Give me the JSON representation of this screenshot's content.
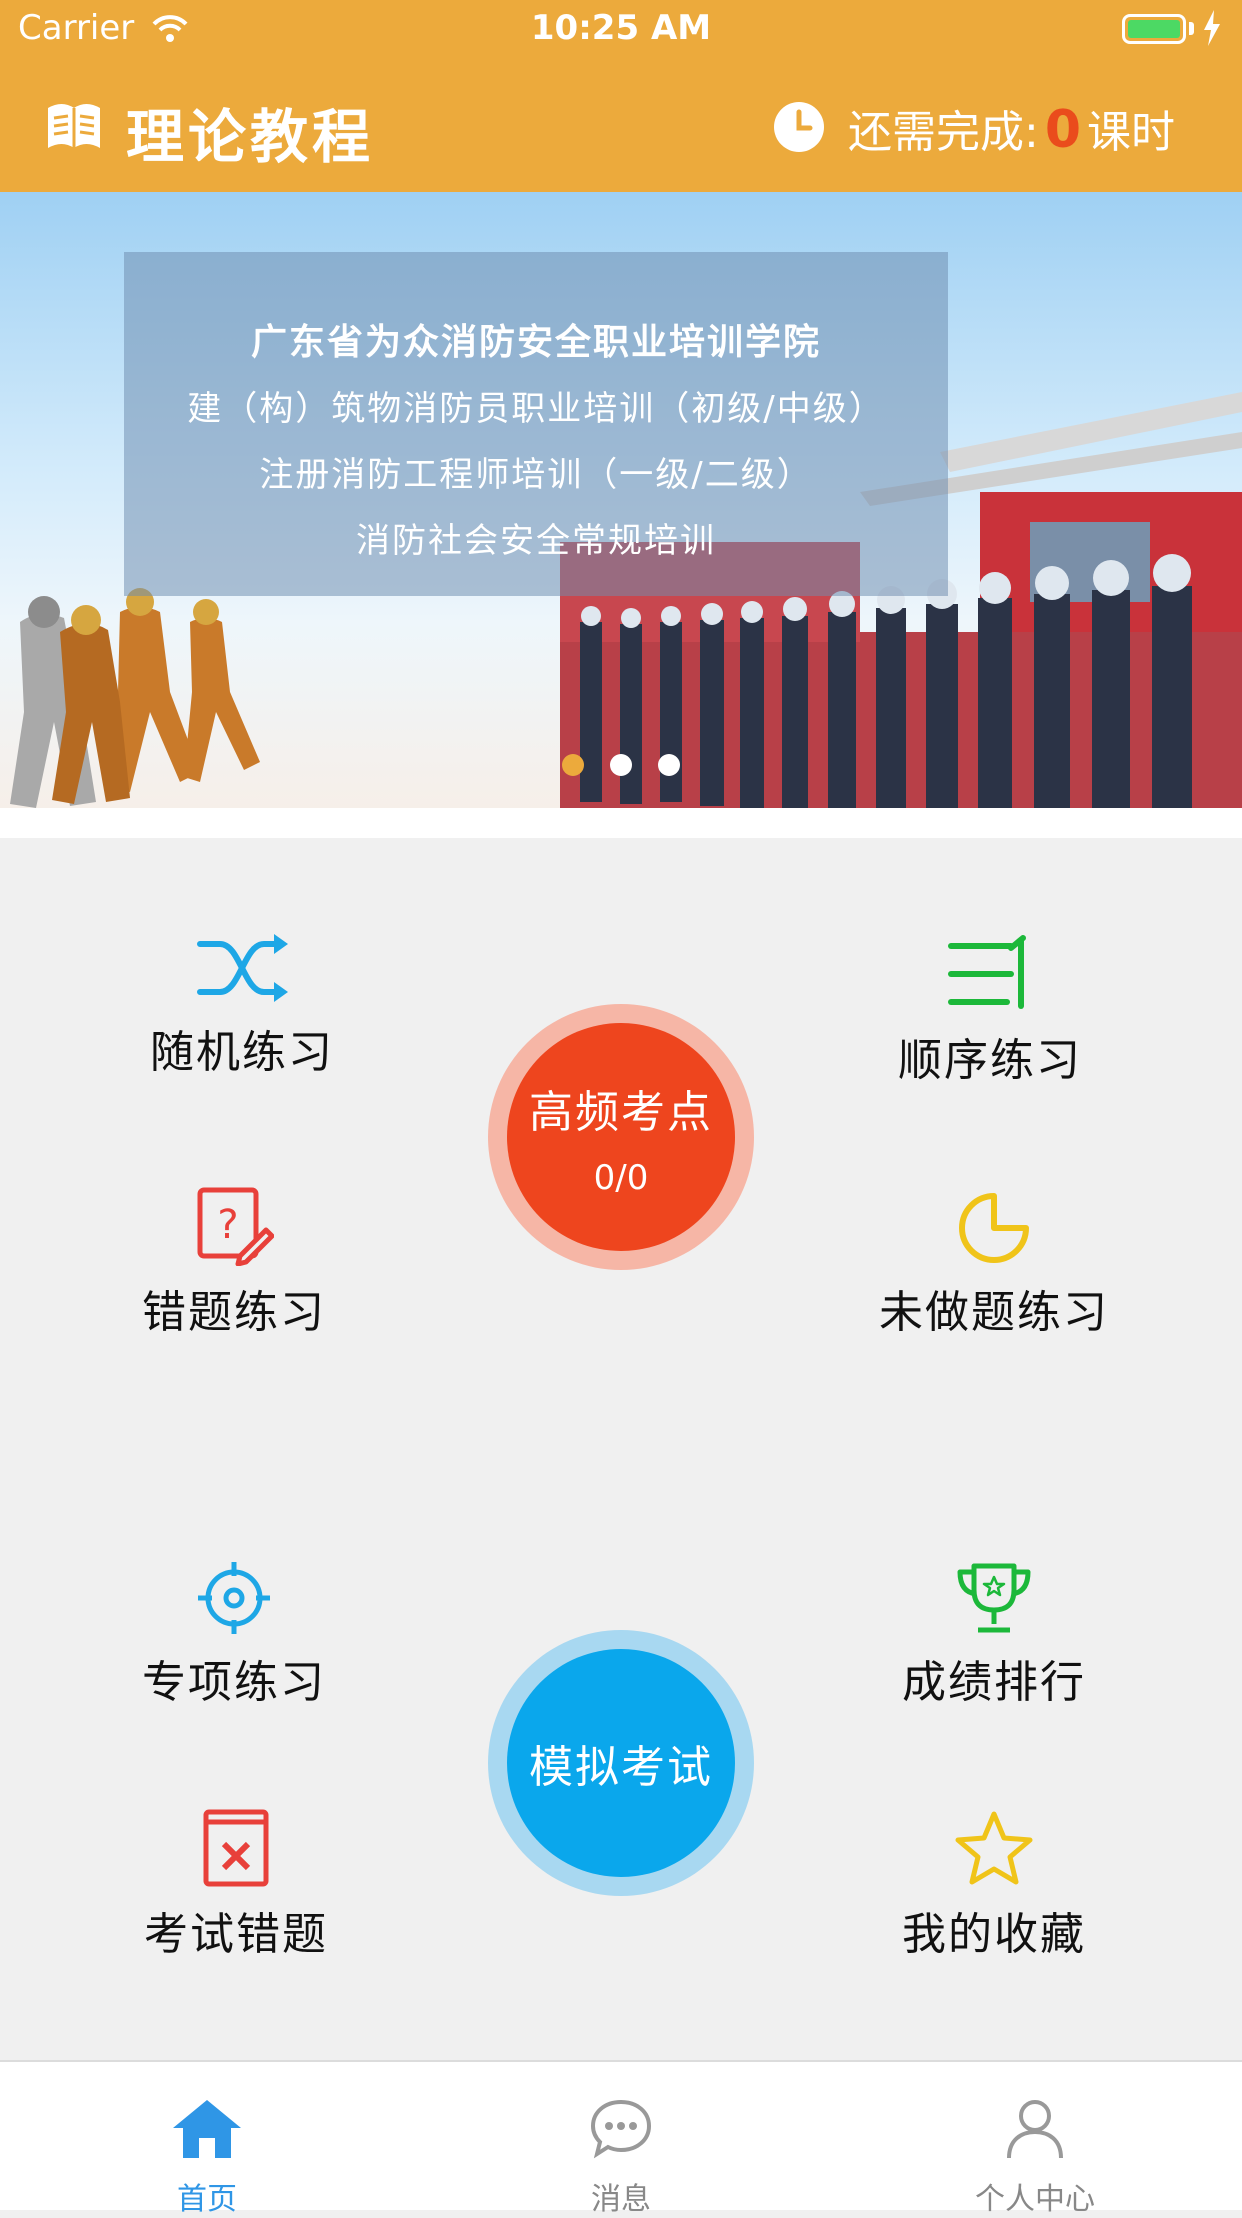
{
  "status_bar": {
    "carrier": "Carrier",
    "time": "10:25 AM"
  },
  "header": {
    "title": "理论教程",
    "remaining_label": "还需完成:",
    "remaining_count": "0",
    "remaining_unit": "课时"
  },
  "banner": {
    "lines": [
      "广东省为众消防安全职业培训学院",
      "建（构）筑物消防员职业培训（初级/中级）",
      "注册消防工程师培训（一级/二级）",
      "消防社会安全常规培训"
    ],
    "slide_count": 3,
    "active_slide": 1
  },
  "features": {
    "random": {
      "label": "随机练习",
      "icon": "shuffle-icon",
      "color": "#1ea7e6"
    },
    "sequential": {
      "label": "顺序练习",
      "icon": "ordered-list-icon",
      "color": "#1cb83a"
    },
    "wrong": {
      "label": "错题练习",
      "icon": "question-edit-icon",
      "color": "#e8403a"
    },
    "undone": {
      "label": "未做题练习",
      "icon": "pie-icon",
      "color": "#f0c419"
    },
    "special": {
      "label": "专项练习",
      "icon": "target-icon",
      "color": "#1ea7e6"
    },
    "ranking": {
      "label": "成绩排行",
      "icon": "trophy-icon",
      "color": "#1cb83a"
    },
    "exam_wrong": {
      "label": "考试错题",
      "icon": "book-x-icon",
      "color": "#e8403a"
    },
    "favorites": {
      "label": "我的收藏",
      "icon": "star-icon",
      "color": "#f0c419"
    }
  },
  "high_freq": {
    "label": "高频考点",
    "count": "0/0",
    "color": "#ee451e"
  },
  "mock_exam": {
    "label": "模拟考试",
    "color": "#0aa7ec"
  },
  "tabbar": {
    "tabs": [
      {
        "label": "首页",
        "icon": "home-icon",
        "active": true
      },
      {
        "label": "消息",
        "icon": "message-icon",
        "active": false
      },
      {
        "label": "个人中心",
        "icon": "user-icon",
        "active": false
      }
    ]
  },
  "colors": {
    "brand": "#ecaa3c",
    "tab_active": "#2f96e6",
    "tab_inactive": "#888888"
  }
}
